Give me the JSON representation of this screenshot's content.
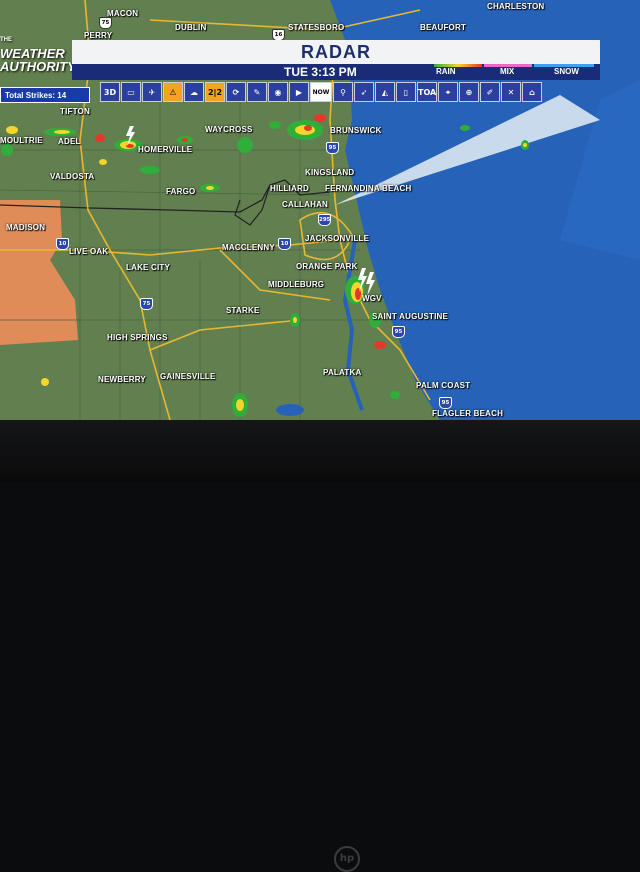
{
  "header": {
    "title": "RADAR",
    "time": "TUE 3:13 PM"
  },
  "logo": {
    "top": "THE",
    "line1": "WEATHER",
    "line2": "AUTHORITY"
  },
  "legend": {
    "rain": "RAIN",
    "mix": "MIX",
    "snow": "SNOW",
    "colors": {
      "rain": [
        "#2fae3a",
        "#f4d52a",
        "#e5382a"
      ],
      "mix": "#e86bc8",
      "snow": "#3ea0f0"
    }
  },
  "strikes": {
    "label": "Total Strikes: 14"
  },
  "toolbar": [
    {
      "name": "3d-button",
      "label": "3D"
    },
    {
      "name": "screen-icon",
      "label": "▭"
    },
    {
      "name": "plane-icon",
      "label": "✈"
    },
    {
      "name": "warning-icon",
      "label": "⚠",
      "hl": true
    },
    {
      "name": "cloud-icon",
      "label": "☁"
    },
    {
      "name": "split-icon",
      "label": "2|2",
      "hl": true
    },
    {
      "name": "refresh-icon",
      "label": "⟳"
    },
    {
      "name": "dropper-icon",
      "label": "✎"
    },
    {
      "name": "eye-icon",
      "label": "◉"
    },
    {
      "name": "play-icon",
      "label": "▶"
    },
    {
      "name": "now-button",
      "label": "NOW",
      "wide": true
    },
    {
      "name": "pin-icon",
      "label": "⚲"
    },
    {
      "name": "rocket-icon",
      "label": "➶"
    },
    {
      "name": "pizza-icon",
      "label": "◭"
    },
    {
      "name": "phone-icon",
      "label": "▯"
    },
    {
      "name": "toa-button",
      "label": "TOA"
    },
    {
      "name": "location-icon",
      "label": "⌖"
    },
    {
      "name": "zoom-icon",
      "label": "⊕"
    },
    {
      "name": "pen-icon",
      "label": "✐"
    },
    {
      "name": "close-icon",
      "label": "✕"
    },
    {
      "name": "home-icon",
      "label": "⌂"
    }
  ],
  "cities": [
    "MACON",
    "DUBLIN",
    "STATESBORO",
    "CHARLESTON",
    "PERRY",
    "BEAUFORT",
    "TIFTON",
    "MOULTRIE",
    "ADEL",
    "HOMERVILLE",
    "WAYCROSS",
    "BRUNSWICK",
    "VALDOSTA",
    "FARGO",
    "KINGSLAND",
    "HILLIARD",
    "FERNANDINA BEACH",
    "CALLAHAN",
    "MADISON",
    "JACKSONVILLE",
    "LIVE OAK",
    "MACCLENNY",
    "LAKE CITY",
    "ORANGE PARK",
    "MIDDLEBURG",
    "WGV",
    "STARKE",
    "SAINT AUGUSTINE",
    "HIGH SPRINGS",
    "PALATKA",
    "NEWBERRY",
    "GAINESVILLE",
    "PALM COAST",
    "FLAGLER BEACH"
  ],
  "highways": [
    "75",
    "16",
    "95",
    "10",
    "295",
    "95",
    "10",
    "75",
    "95"
  ]
}
